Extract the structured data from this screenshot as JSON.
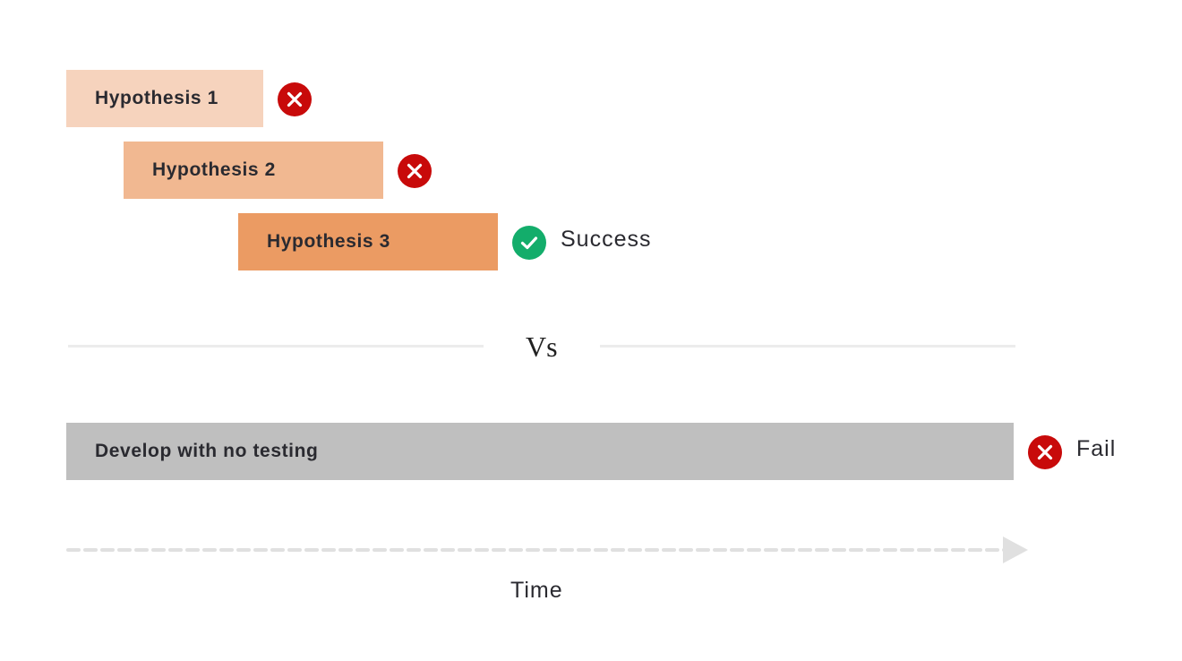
{
  "colors": {
    "hypothesis_1": "#f6d3bd",
    "hypothesis_2": "#f1b891",
    "hypothesis_3": "#eb9b63",
    "no_testing": "#bfbfbf",
    "fail": "#c80a0a",
    "success": "#13ad6b",
    "divider": "#ececec",
    "timeline": "#e0e0e0"
  },
  "hypotheses": [
    {
      "label": "Hypothesis 1",
      "status": "fail",
      "icon": "x-circle-icon"
    },
    {
      "label": "Hypothesis 2",
      "status": "fail",
      "icon": "x-circle-icon"
    },
    {
      "label": "Hypothesis 3",
      "status": "success",
      "icon": "check-circle-icon",
      "status_label": "Success"
    }
  ],
  "divider_label": "Vs",
  "no_testing": {
    "label": "Develop with no testing",
    "status": "fail",
    "icon": "x-circle-icon",
    "status_label": "Fail"
  },
  "timeline": {
    "label": "Time",
    "icon": "arrow-right-icon"
  }
}
